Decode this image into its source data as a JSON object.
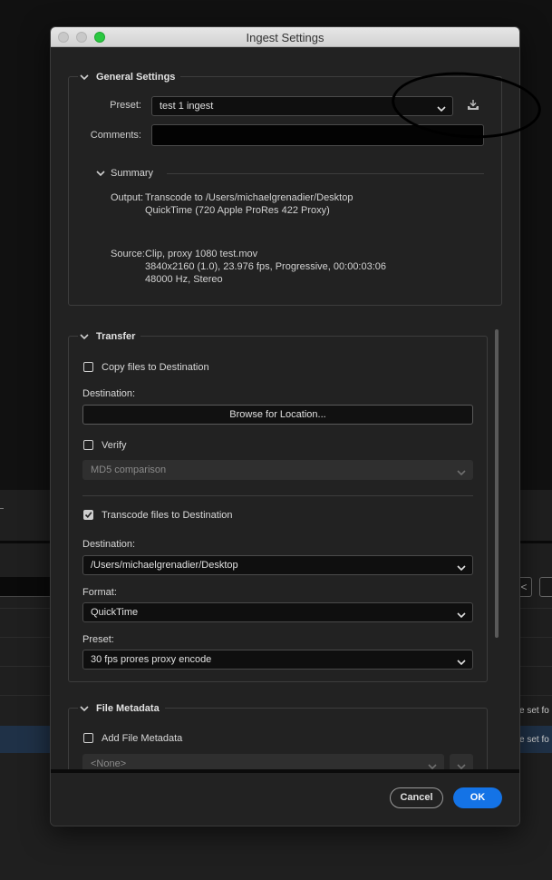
{
  "window": {
    "title": "Ingest Settings"
  },
  "general": {
    "header": "General Settings",
    "preset_label": "Preset:",
    "preset_value": "test 1 ingest",
    "comments_label": "Comments:",
    "comments_value": "",
    "save_icon": "download-tray-icon"
  },
  "summary": {
    "header": "Summary",
    "output_label": "Output:",
    "output_line1": "Transcode to /Users/michaelgrenadier/Desktop",
    "output_line2": "QuickTime (720 Apple ProRes 422 Proxy)",
    "source_label": "Source:",
    "source_line1": "Clip, proxy 1080 test.mov",
    "source_line2": "3840x2160 (1.0), 23.976 fps, Progressive, 00:00:03:06",
    "source_line3": "48000 Hz, Stereo"
  },
  "transfer": {
    "header": "Transfer",
    "copy_label": "Copy files to Destination",
    "copy_checked": false,
    "destination_label": "Destination:",
    "browse_label": "Browse for Location...",
    "verify_label": "Verify",
    "verify_checked": false,
    "verify_method": "MD5 comparison",
    "transcode_label": "Transcode files to Destination",
    "transcode_checked": true,
    "transcode_destination_label": "Destination:",
    "transcode_destination_value": "/Users/michaelgrenadier/Desktop",
    "format_label": "Format:",
    "format_value": "QuickTime",
    "preset_label": "Preset:",
    "preset_value": "30 fps prores proxy encode"
  },
  "metadata": {
    "header": "File Metadata",
    "add_label": "Add File Metadata",
    "add_checked": false,
    "metadata_value": "<None>"
  },
  "footer": {
    "cancel_label": "Cancel",
    "ok_label": "OK"
  },
  "background": {
    "row_text_1": "e set fo",
    "row_text_2": "e set fo",
    "btn_glyph": "<"
  },
  "colors": {
    "accent": "#1473e6",
    "dialog_bg": "#222222",
    "annotation": "#000000"
  }
}
